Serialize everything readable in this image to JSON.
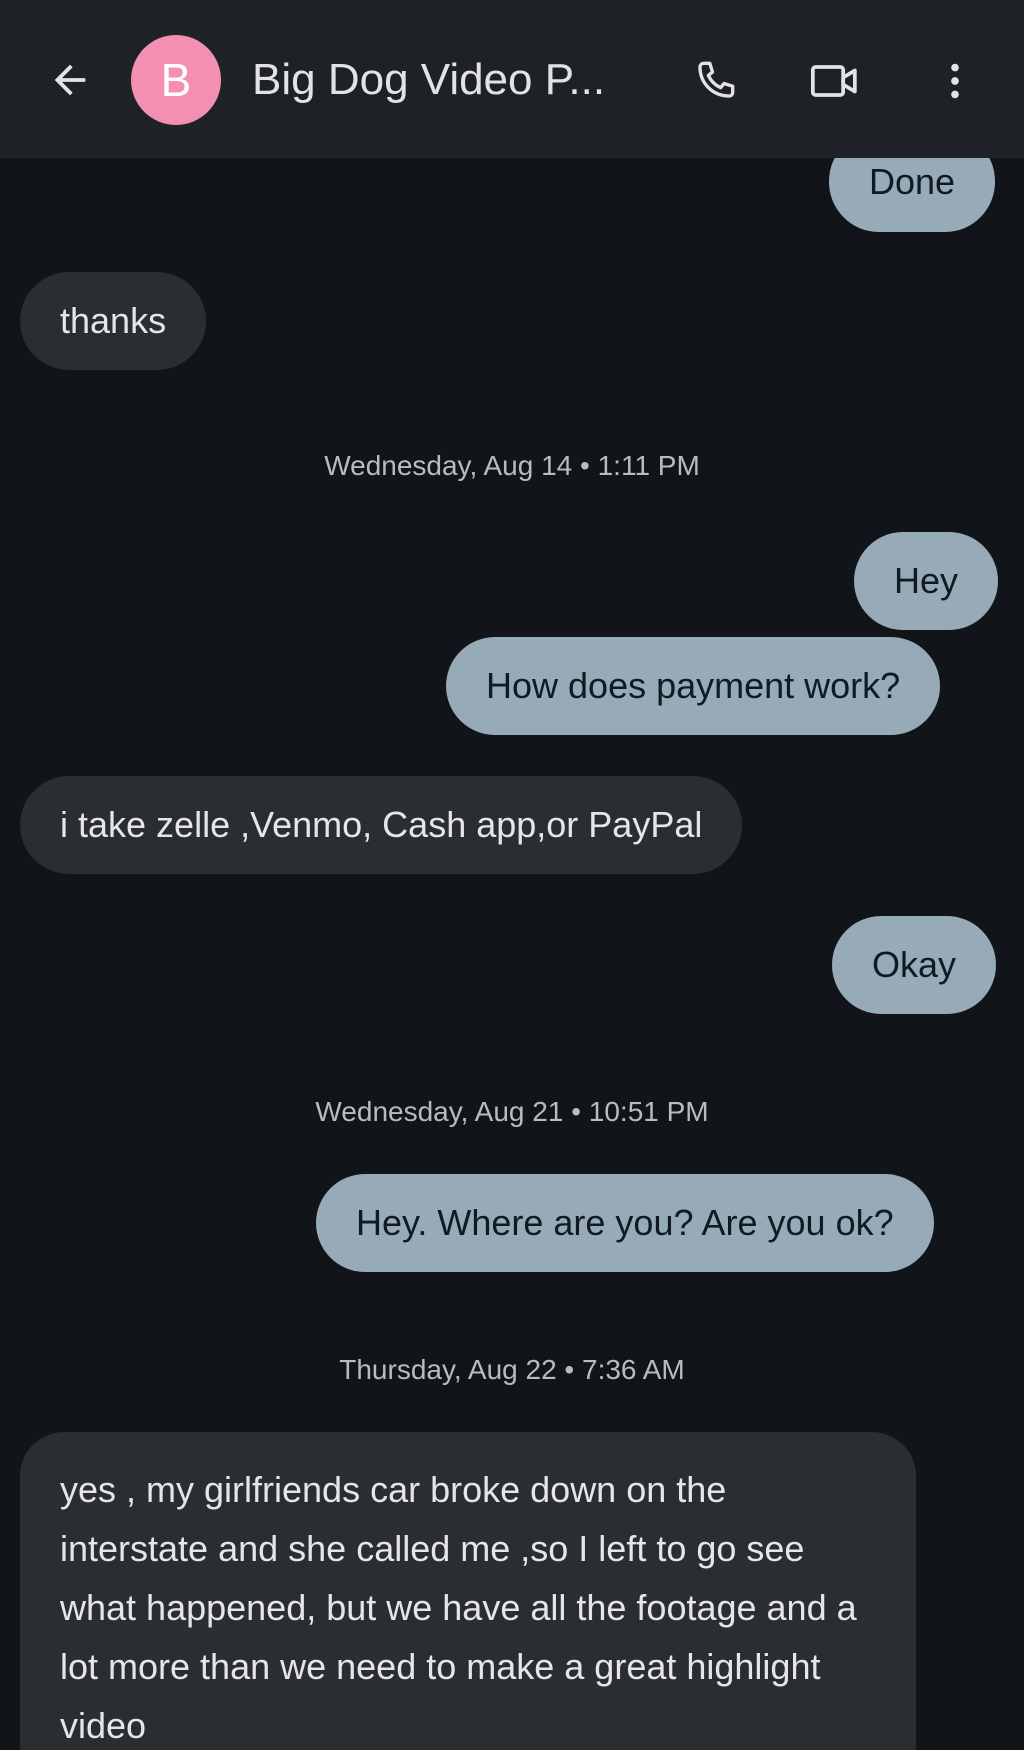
{
  "header": {
    "contact_initial": "B",
    "contact_name": "Big Dog Video P...",
    "avatar_color": "#f48fb1",
    "background": "#1e2226"
  },
  "icons": {
    "back": "arrow-left-icon",
    "call": "phone-icon",
    "video": "video-camera-icon",
    "more": "more-vertical-icon"
  },
  "colors": {
    "outgoing_bubble": "#97aab8",
    "incoming_bubble": "#2a2e33",
    "background": "#111418"
  },
  "messages": {
    "m1": "Done",
    "m2": "thanks",
    "sep1": "Wednesday, Aug 14 • 1:11 PM",
    "m3": "Hey",
    "m4": "How does payment work?",
    "m5": "i take zelle ,Venmo, Cash app,or PayPal",
    "m6": "Okay",
    "sep2": "Wednesday, Aug 21 • 10:51 PM",
    "m7": "Hey. Where are you? Are you ok?",
    "sep3": "Thursday, Aug 22 • 7:36 AM",
    "m8": "yes , my girlfriends car broke down on the interstate and she called me ,so I left to go see what happened, but we have all the footage and a lot more than we need to make a great highlight video"
  }
}
